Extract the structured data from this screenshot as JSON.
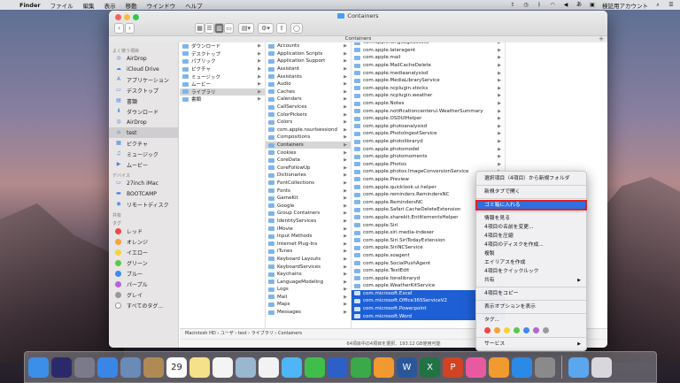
{
  "menubar": {
    "app_name": "Finder",
    "items": [
      "ファイル",
      "編集",
      "表示",
      "移動",
      "ウインドウ",
      "ヘルプ"
    ],
    "user": "検証用アカウント"
  },
  "window": {
    "title": "Containers",
    "tab_title": "Containers",
    "path": [
      "Macintosh HD",
      "ユーザ",
      "test",
      "ライブラリ",
      "Containers"
    ],
    "status": "64項目中の4項目を選択、193.12 GB使用可能"
  },
  "sidebar": {
    "sections": [
      {
        "header": "よく使う項目",
        "items": [
          {
            "label": "AirDrop",
            "icon": "airdrop-icon"
          },
          {
            "label": "iCloud Drive",
            "icon": "cloud-icon"
          },
          {
            "label": "アプリケーション",
            "icon": "apps-icon"
          },
          {
            "label": "デスクトップ",
            "icon": "desktop-icon"
          },
          {
            "label": "書類",
            "icon": "document-icon"
          },
          {
            "label": "ダウンロード",
            "icon": "download-icon"
          },
          {
            "label": "AirDrop",
            "icon": "airdrop-icon"
          },
          {
            "label": "test",
            "icon": "home-icon",
            "selected": true
          },
          {
            "label": "ピクチャ",
            "icon": "pictures-icon"
          },
          {
            "label": "ミュージック",
            "icon": "music-icon"
          },
          {
            "label": "ムービー",
            "icon": "movie-icon"
          }
        ]
      },
      {
        "header": "デバイス",
        "items": [
          {
            "label": "27inch iMac",
            "icon": "computer-icon"
          },
          {
            "label": "BOOTCAMP",
            "icon": "disk-icon"
          },
          {
            "label": "リモートディスク",
            "icon": "remote-disk-icon"
          }
        ]
      },
      {
        "header": "共有",
        "items": []
      },
      {
        "header": "タグ",
        "items": [
          {
            "label": "レッド",
            "color": "#f0483e"
          },
          {
            "label": "オレンジ",
            "color": "#f6a33a"
          },
          {
            "label": "イエロー",
            "color": "#f5d33b"
          },
          {
            "label": "グリーン",
            "color": "#5ec64a"
          },
          {
            "label": "ブルー",
            "color": "#3f8af0"
          },
          {
            "label": "パープル",
            "color": "#b464d8"
          },
          {
            "label": "グレイ",
            "color": "#9a9a9a"
          },
          {
            "label": "すべてのタグ...",
            "color": "#ffffff"
          }
        ]
      }
    ]
  },
  "columns": {
    "col1": [
      {
        "label": "ダウンロード",
        "arrow": true
      },
      {
        "label": "デスクトップ",
        "arrow": true
      },
      {
        "label": "パブリック",
        "arrow": true
      },
      {
        "label": "ピクチャ",
        "arrow": true
      },
      {
        "label": "ミュージック",
        "arrow": true
      },
      {
        "label": "ムービー",
        "arrow": true
      },
      {
        "label": "ライブラリ",
        "arrow": true,
        "state": "gray"
      },
      {
        "label": "書類",
        "arrow": true
      }
    ],
    "col2": [
      "Accounts",
      "Application Scripts",
      "Application Support",
      "Assistant",
      "Assistants",
      "Audio",
      "Caches",
      "Calendars",
      "CallServices",
      "ColorPickers",
      "Colors",
      "com.apple.nsurlsessiond",
      "Compositions",
      "Containers",
      "Cookies",
      "CoreData",
      "CoreFollowUp",
      "Dictionaries",
      "FontCollections",
      "Fonts",
      "GameKit",
      "Google",
      "Group Containers",
      "IdentityServices",
      "iMovie",
      "Input Methods",
      "Internet Plug-Ins",
      "iTunes",
      "Keyboard Layouts",
      "KeyboardServices",
      "Keychains",
      "LanguageModeling",
      "Logs",
      "Mail",
      "Maps",
      "Messages"
    ],
    "col2_selected": "Containers",
    "col3": [
      "com.apple.languageassetd",
      "com.apple.lateragent",
      "com.apple.mail",
      "com.apple.MailCacheDelete",
      "com.apple.mediaanalysisd",
      "com.apple.MediaLibraryService",
      "com.apple.ncplugin.stocks",
      "com.apple.ncplugin.weather",
      "com.apple.Notes",
      "com.apple.notificationcenterui.WeatherSummary",
      "com.apple.OSDUIHelper",
      "com.apple.photoanalysisd",
      "com.apple.PhotoIngestService",
      "com.apple.photolibraryd",
      "com.apple.photomodel",
      "com.apple.photomoments",
      "com.apple.Photos",
      "com.apple.photos.ImageConversionService",
      "com.apple.Preview",
      "com.apple.quicklook.ui.helper",
      "com.apple.reminders.RemindersNC",
      "com.apple.RemindersNC",
      "com.apple.Safari.CacheDeleteExtension",
      "com.apple.sharekit.EntitlementsHelper",
      "com.apple.Siri",
      "com.apple.siri.media-indexer",
      "com.apple.Siri.SiriTodayExtension",
      "com.apple.SiriNCService",
      "com.apple.soagent",
      "com.apple.SocialPushAgent",
      "com.apple.TextEdit",
      "com.apple.tonelibraryd",
      "com.apple.WeatherKitService",
      "com.microsoft.Excel",
      "com.microsoft.Office365ServiceV2",
      "com.microsoft.Powerpoint",
      "com.microsoft.Word"
    ],
    "col3_selected": [
      "com.microsoft.Excel",
      "com.microsoft.Office365ServiceV2",
      "com.microsoft.Powerpoint",
      "com.microsoft.Word"
    ]
  },
  "context_menu": {
    "items": [
      {
        "label": "選択項目（4項目）から新規フォルダ"
      },
      {
        "sep": true
      },
      {
        "label": "新規タブで開く"
      },
      {
        "sep": true
      },
      {
        "label": "ゴミ箱に入れる",
        "highlight": true
      },
      {
        "sep": true
      },
      {
        "label": "情報を見る"
      },
      {
        "label": "4項目の名前を変更..."
      },
      {
        "label": "4項目を圧縮"
      },
      {
        "label": "4項目のディスクを作成..."
      },
      {
        "label": "複製"
      },
      {
        "label": "エイリアスを作成"
      },
      {
        "label": "4項目をクイックルック"
      },
      {
        "label": "共有",
        "submenu": true
      },
      {
        "sep": true
      },
      {
        "label": "4項目をコピー"
      },
      {
        "sep": true
      },
      {
        "label": "表示オプションを表示"
      },
      {
        "sep": true
      },
      {
        "label": "タグ..."
      },
      {
        "tags": [
          "#f0483e",
          "#f6a33a",
          "#f5d33b",
          "#5ec64a",
          "#3f8af0",
          "#b464d8",
          "#9a9a9a"
        ]
      },
      {
        "sep": true
      },
      {
        "label": "サービス",
        "submenu": true
      }
    ]
  },
  "dock": {
    "apps": [
      {
        "name": "finder-icon",
        "color": "#3b8fe8"
      },
      {
        "name": "siri-icon",
        "color": "#2a2a6a"
      },
      {
        "name": "launchpad-icon",
        "color": "#7a7a8a"
      },
      {
        "name": "safari-icon",
        "color": "#3a86e6"
      },
      {
        "name": "mail-stamp-icon",
        "color": "#6a8ab8"
      },
      {
        "name": "contacts-icon",
        "color": "#b08a55"
      },
      {
        "name": "calendar-icon",
        "color": "#ffffff",
        "text": "29"
      },
      {
        "name": "notes-icon",
        "color": "#f5e18a"
      },
      {
        "name": "reminders-icon",
        "color": "#f4f4f4"
      },
      {
        "name": "preview-icon",
        "color": "#9ab7d0"
      },
      {
        "name": "photos-icon",
        "color": "#f2f2f2"
      },
      {
        "name": "messages-icon",
        "color": "#4fb5f5"
      },
      {
        "name": "facetime-icon",
        "color": "#3fbf4a"
      },
      {
        "name": "keynote-icon",
        "color": "#2e5fc6"
      },
      {
        "name": "numbers-icon",
        "color": "#3aa94a"
      },
      {
        "name": "pages-icon",
        "color": "#f19a2f"
      },
      {
        "name": "word-icon",
        "color": "#2b579a",
        "text": "W"
      },
      {
        "name": "excel-icon",
        "color": "#217346",
        "text": "X"
      },
      {
        "name": "powerpoint-icon",
        "color": "#d04423",
        "text": "P"
      },
      {
        "name": "itunes-icon",
        "color": "#e85aa0"
      },
      {
        "name": "ibooks-icon",
        "color": "#f19a2f"
      },
      {
        "name": "appstore-icon",
        "color": "#2a8ae6"
      },
      {
        "name": "system-preferences-icon",
        "color": "#8a8a8a"
      }
    ],
    "right": [
      {
        "name": "folder-icon",
        "color": "#5aa7ee"
      },
      {
        "name": "trash-icon",
        "color": "#d8d8dc"
      }
    ]
  }
}
